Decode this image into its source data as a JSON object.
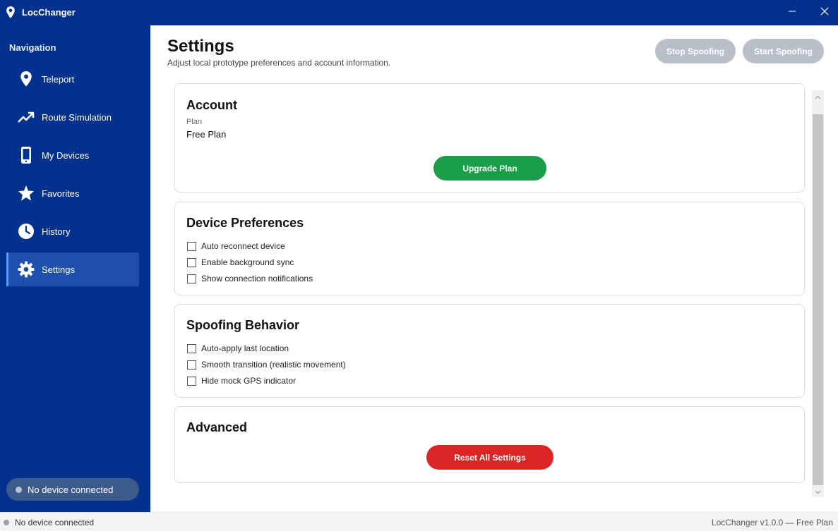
{
  "app": {
    "title": "LocChanger",
    "icons": {
      "logo": "map-pin-icon",
      "minimize": "minimize-icon",
      "close": "close-icon"
    }
  },
  "sidebar": {
    "heading": "Navigation",
    "items": [
      {
        "label": "Teleport",
        "icon": "map-pin-icon",
        "active": false
      },
      {
        "label": "Route Simulation",
        "icon": "trending-up-icon",
        "active": false
      },
      {
        "label": "My Devices",
        "icon": "smartphone-icon",
        "active": false
      },
      {
        "label": "Favorites",
        "icon": "star-icon",
        "active": false
      },
      {
        "label": "History",
        "icon": "clock-icon",
        "active": false
      },
      {
        "label": "Settings",
        "icon": "gear-icon",
        "active": true
      }
    ],
    "device_status": "No device connected"
  },
  "header": {
    "title": "Settings",
    "subtitle": "Adjust local prototype preferences and account information.",
    "stop_label": "Stop Spoofing",
    "start_label": "Start Spoofing"
  },
  "account": {
    "title": "Account",
    "plan_label": "Plan",
    "plan_value": "Free Plan",
    "upgrade_label": "Upgrade Plan"
  },
  "device_prefs": {
    "title": "Device Preferences",
    "options": [
      {
        "label": "Auto reconnect device",
        "checked": false
      },
      {
        "label": "Enable background sync",
        "checked": false
      },
      {
        "label": "Show connection notifications",
        "checked": false
      }
    ]
  },
  "spoofing": {
    "title": "Spoofing Behavior",
    "options": [
      {
        "label": "Auto-apply last location",
        "checked": false
      },
      {
        "label": "Smooth transition (realistic movement)",
        "checked": false
      },
      {
        "label": "Hide mock GPS indicator",
        "checked": false
      }
    ]
  },
  "advanced": {
    "title": "Advanced",
    "reset_label": "Reset All Settings"
  },
  "statusbar": {
    "left": "No device connected",
    "right": "LocChanger v1.0.0 — Free Plan"
  },
  "colors": {
    "brand": "#04318e",
    "active_nav": "#1e4fae",
    "upgrade": "#1a9e47",
    "reset": "#dc2626",
    "disabled_btn": "#b9bfc8"
  }
}
